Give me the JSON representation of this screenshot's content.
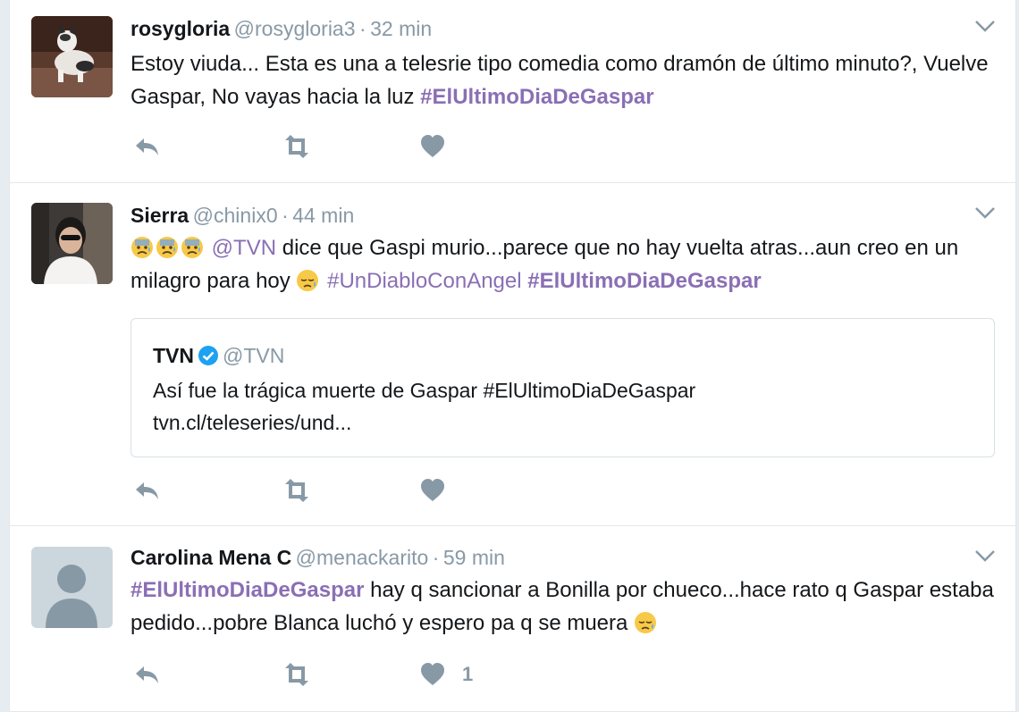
{
  "tweets": [
    {
      "fullname": "rosygloria",
      "handle": "@rosygloria3",
      "separator": "·",
      "time": "32 min",
      "text_plain": "Estoy viuda... Esta es una a telesrie tipo comedia como dramón de último minuto?, Vuelve Gaspar, No vayas hacia la luz ",
      "hashtag": "#ElUltimoDiaDeGaspar"
    },
    {
      "fullname": "Sierra",
      "handle": "@chinix0",
      "separator": "·",
      "time": "44 min",
      "emojis": [
        "anxious-face-emoji",
        "anxious-face-emoji",
        "anxious-face-emoji"
      ],
      "mention": "@TVN",
      "text_plain_1": " dice que Gaspi murio...parece que no hay vuelta atras...aun creo en un milagro para hoy ",
      "emoji_inline": "sad-relieved-face-emoji",
      "hashtag_1": "#UnDiabloConAngel",
      "hashtag_2": "#ElUltimoDiaDeGaspar",
      "quote": {
        "name": "TVN",
        "handle": "@TVN",
        "text_line1": "Así fue la trágica muerte de Gaspar #ElUltimoDiaDeGaspar",
        "text_line2": "tvn.cl/teleseries/und..."
      }
    },
    {
      "fullname": "Carolina Mena C",
      "handle": "@menackarito",
      "separator": "·",
      "time": "59 min",
      "hashtag": "#ElUltimoDiaDeGaspar",
      "text_plain": " hay q sancionar a Bonilla por chueco...hace rato q Gaspar estaba pedido...pobre Blanca luchó y espero pa q se muera ",
      "like_count": "1"
    }
  ],
  "icons": {
    "reply": "reply-icon",
    "retweet": "retweet-icon",
    "like": "heart-icon",
    "more": "chevron-down-icon",
    "verified": "verified-badge-icon"
  },
  "colors": {
    "hashtag": "#8a6fb4",
    "muted": "#8899a6",
    "text": "#14171a",
    "verified": "#1da1f2"
  }
}
